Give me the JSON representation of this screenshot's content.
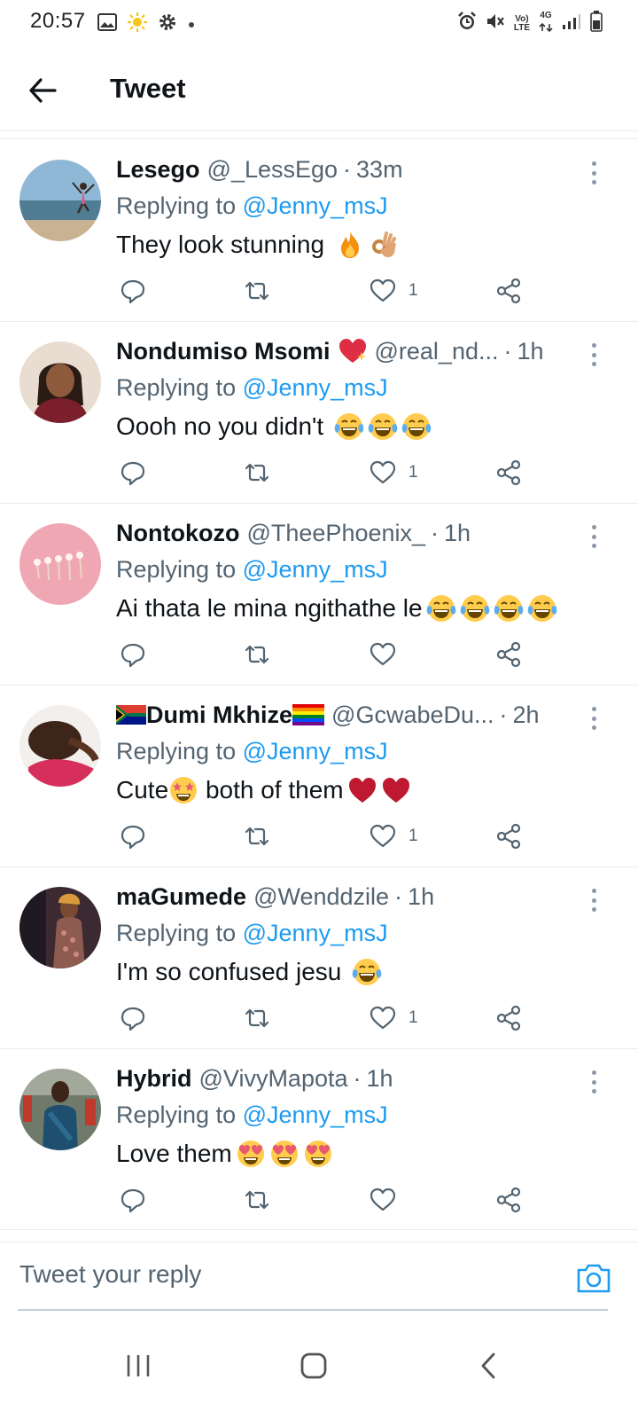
{
  "status_bar": {
    "time": "20:57",
    "network_label_top": "Vo)",
    "network_label_bottom": "LTE",
    "data_label": "4G"
  },
  "header": {
    "title": "Tweet"
  },
  "replies": [
    {
      "name": "Lesego",
      "handle": "@_LessEgo",
      "time": "33m",
      "replying_prefix": "Replying to",
      "replying_to": "@Jenny_msJ",
      "text": "They look stunning",
      "emojis": [
        "fire",
        "ok-hand"
      ],
      "like_count": "1"
    },
    {
      "name": "Nondumiso Msomi",
      "handle": "@real_nd...",
      "time": "1h",
      "replying_prefix": "Replying to",
      "replying_to": "@Jenny_msJ",
      "text": "Oooh no you didn't",
      "emojis": [
        "tears-of-joy",
        "tears-of-joy",
        "tears-of-joy"
      ],
      "like_count": "1"
    },
    {
      "name": "Nontokozo",
      "handle": "@TheePhoenix_",
      "time": "1h",
      "replying_prefix": "Replying to",
      "replying_to": "@Jenny_msJ",
      "text": "Ai thata le mina ngithathe le",
      "emojis": [
        "tears-of-joy",
        "tears-of-joy",
        "tears-of-joy",
        "tears-of-joy"
      ],
      "like_count": ""
    },
    {
      "name": "Dumi Mkhize",
      "handle": "@GcwabeDu...",
      "time": "2h",
      "replying_prefix": "Replying to",
      "replying_to": "@Jenny_msJ",
      "text_before": "Cute",
      "text_after": "both of them",
      "emojis": [
        "star-struck",
        "red-heart",
        "red-heart"
      ],
      "like_count": "1"
    },
    {
      "name": "maGumede",
      "handle": "@Wenddzile",
      "time": "1h",
      "replying_prefix": "Replying to",
      "replying_to": "@Jenny_msJ",
      "text": "I'm so confused jesu",
      "emojis": [
        "tears-of-joy"
      ],
      "like_count": "1"
    },
    {
      "name": "Hybrid",
      "handle": "@VivyMapota",
      "time": "1h",
      "replying_prefix": "Replying to",
      "replying_to": "@Jenny_msJ",
      "text": "Love them",
      "emojis": [
        "heart-eyes",
        "heart-eyes",
        "heart-eyes"
      ],
      "like_count": ""
    }
  ],
  "composer": {
    "placeholder": "Tweet your reply"
  },
  "colors": {
    "accent": "#1d9bf0",
    "secondary_text": "#536471",
    "divider": "#e6ecf0"
  }
}
